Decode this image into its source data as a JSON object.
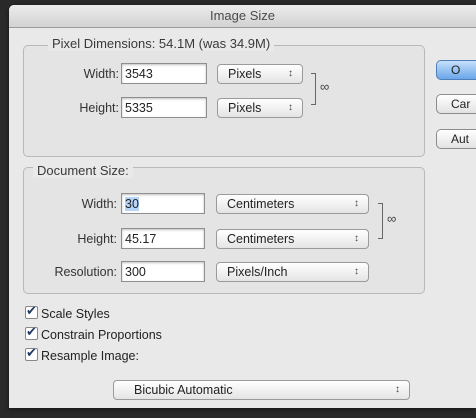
{
  "dialog": {
    "title": "Image Size"
  },
  "buttons": {
    "ok": "O",
    "cancel": "Car",
    "auto": "Aut"
  },
  "pixel_dimensions": {
    "legend": "Pixel Dimensions:  54.1M (was 34.9M)",
    "width_label": "Width:",
    "width_value": "3543",
    "width_unit": "Pixels",
    "height_label": "Height:",
    "height_value": "5335",
    "height_unit": "Pixels"
  },
  "document_size": {
    "legend": "Document Size:",
    "width_label": "Width:",
    "width_value": "30",
    "width_unit": "Centimeters",
    "height_label": "Height:",
    "height_value": "45.17",
    "height_unit": "Centimeters",
    "resolution_label": "Resolution:",
    "resolution_value": "300",
    "resolution_unit": "Pixels/Inch"
  },
  "options": {
    "scale_styles": "Scale Styles",
    "constrain_proportions": "Constrain Proportions",
    "resample_image": "Resample Image:",
    "resample_method": "Bicubic Automatic",
    "scale_styles_checked": true,
    "constrain_proportions_checked": true,
    "resample_image_checked": true
  },
  "icons": {
    "chain_pixel": "chain-link-icon",
    "chain_document": "chain-link-icon",
    "popup_arrow": "up-down-arrows-icon"
  }
}
